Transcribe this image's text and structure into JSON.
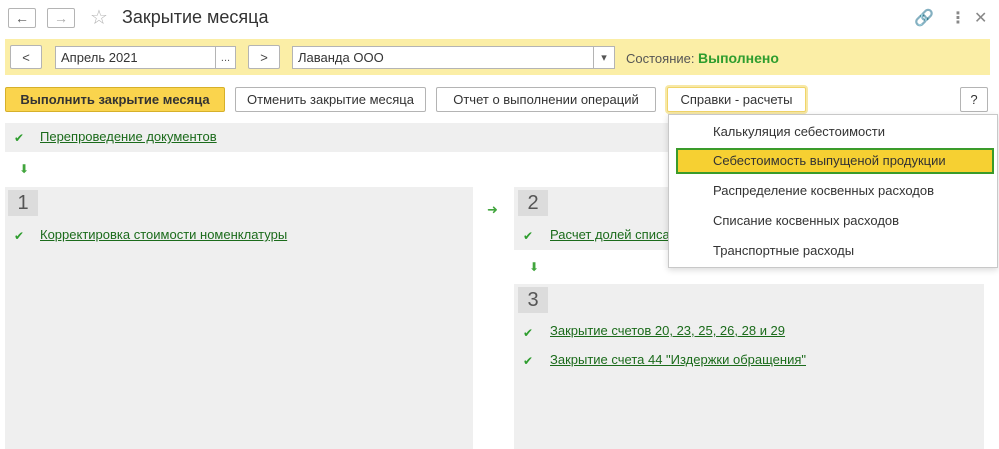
{
  "window": {
    "title": "Закрытие месяца",
    "back_icon": "arrow-left-icon",
    "forward_icon": "arrow-right-icon",
    "star_icon": "star-icon",
    "link_icon": "link-icon",
    "more_icon": "more-vertical-icon",
    "close_icon": "close-icon"
  },
  "filters": {
    "prev_label": "<",
    "period_value": "Апрель 2021",
    "period_select_label": "...",
    "next_label": ">",
    "organization_value": "Лаванда ООО",
    "status_label": "Состояние:",
    "status_value": "Выполнено"
  },
  "toolbar": {
    "run_label": "Выполнить закрытие месяца",
    "cancel_label": "Отменить закрытие месяца",
    "report_label": "Отчет о выполнении операций",
    "references_label": "Справки - расчеты",
    "help_label": "?"
  },
  "steps": {
    "pre_link": "Перепроведение документов",
    "step1": {
      "number": "1",
      "items": [
        "Корректировка стоимости номенклатуры"
      ]
    },
    "step2": {
      "number": "2",
      "items": [
        "Расчет долей списа"
      ]
    },
    "step3": {
      "number": "3",
      "items": [
        "Закрытие счетов 20, 23, 25, 26, 28 и 29",
        "Закрытие счета 44 \"Издержки обращения\""
      ]
    }
  },
  "dropdown": {
    "items": [
      "Калькуляция себестоимости",
      "Себестоимость выпущеной продукции",
      "Распределение косвенных расходов",
      "Списание косвенных расходов",
      "Транспортные расходы"
    ],
    "selected_index": 1
  },
  "colors": {
    "accent_yellow": "#fad44d",
    "panel_yellow": "#fbeea6",
    "status_green": "#2e9d2e",
    "link_green": "#1b6b1b"
  }
}
